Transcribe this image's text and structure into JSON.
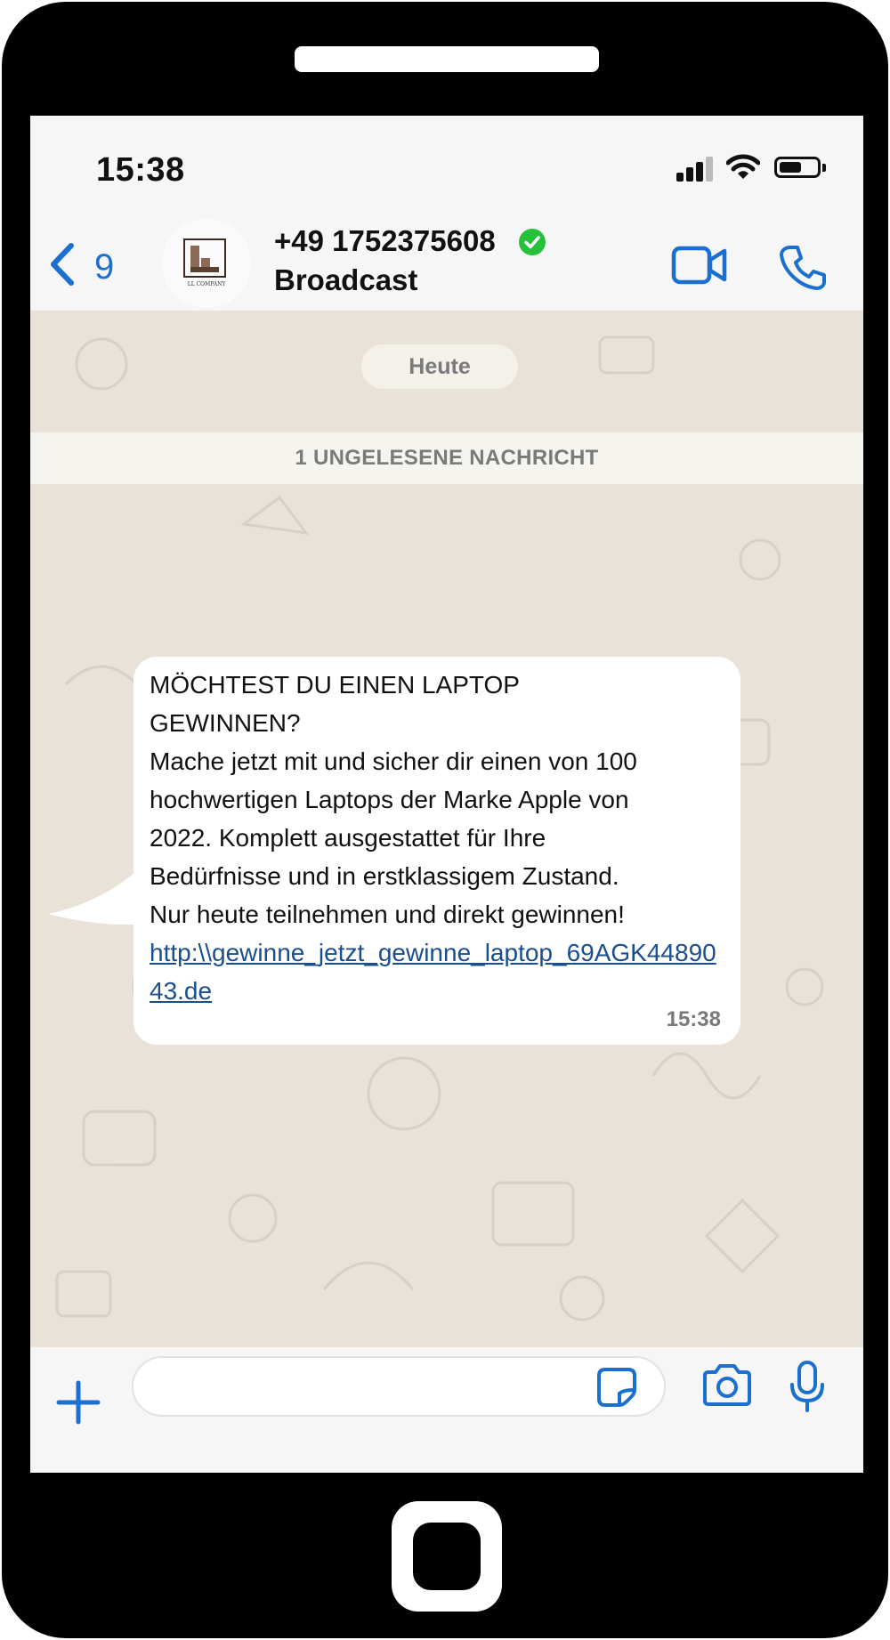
{
  "status_bar": {
    "time": "15:38",
    "battery_level": 0.6
  },
  "header": {
    "back_count": "9",
    "avatar_logo_text": "LL COMPANY",
    "contact_name": "+49 1752375608",
    "contact_subtitle": "Broadcast",
    "icons": [
      "chevron-left-icon",
      "verified-icon",
      "video-call-icon",
      "phone-icon"
    ]
  },
  "chat": {
    "date_label": "Heute",
    "unread_label": "1 UNGELESENE NACHRICHT",
    "message": {
      "text": "MÖCHTEST DU EINEN LAPTOP\nGEWINNEN?\nMache jetzt mit und sicher dir einen von 100\nhochwertigen Laptops der Marke Apple von\n2022. Komplett ausgestattet für Ihre\nBedürfnisse und in erstklassigem Zustand.\nNur heute teilnehmen und direkt gewinnen!",
      "link": "http:\\\\gewinne_jetzt_gewinne_laptop_69AGK4489043.de",
      "time": "15:38"
    }
  },
  "input_bar": {
    "placeholder": "",
    "icons": [
      "plus-icon",
      "sticker-icon",
      "camera-icon",
      "microphone-icon"
    ]
  },
  "colors": {
    "accent": "#1b6fd0",
    "verified": "#25c13a",
    "chat_background": "#e9e2d8",
    "link": "#1a4f8f"
  }
}
